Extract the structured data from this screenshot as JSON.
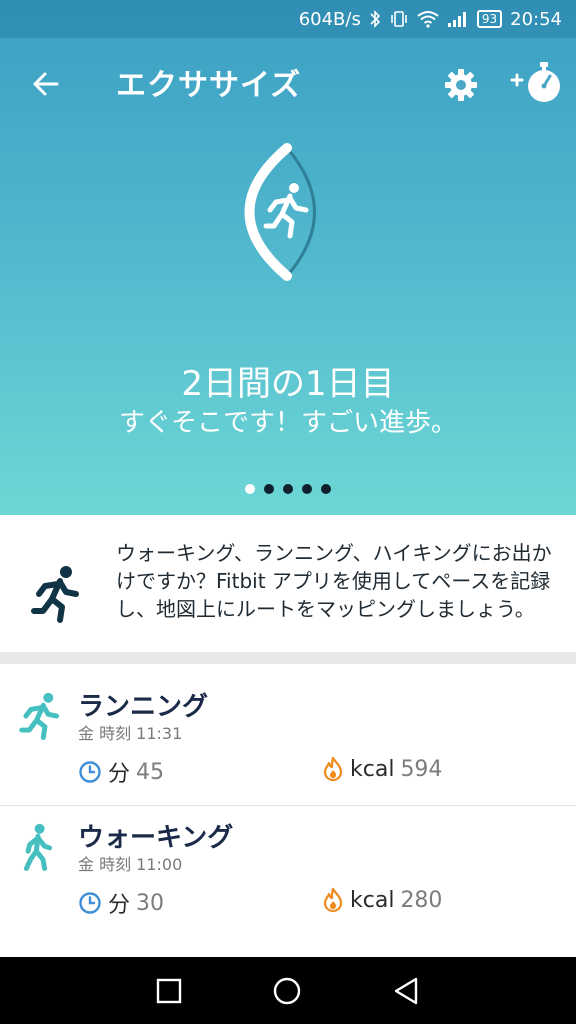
{
  "status_bar": {
    "speed": "604B/s",
    "battery": "93",
    "time": "20:54"
  },
  "app_bar": {
    "title": "エクササイズ",
    "icons": [
      "back-arrow-icon",
      "gear-icon",
      "add-timer-icon"
    ]
  },
  "hero": {
    "title": "2日間の1日目",
    "subtitle": "すぐそこです！すごい進歩。",
    "progress_days": 1,
    "goal_days": 2,
    "pager_total": 5,
    "pager_active": 0
  },
  "info_card": {
    "text": "ウォーキング、ランニング、ハイキングにお出かけですか？Fitbit アプリを使用してペースを記録し、地図上にルートをマッピングしましょう。"
  },
  "activities": [
    {
      "name": "ランニング",
      "time": "金 時刻 11:31",
      "duration_label": "分",
      "duration_value": "45",
      "calories_label": "kcal",
      "calories_value": "594"
    },
    {
      "name": "ウォーキング",
      "time": "金 時刻 11:00",
      "duration_label": "分",
      "duration_value": "30",
      "calories_label": "kcal",
      "calories_value": "280"
    }
  ],
  "colors": {
    "hero_top": "#3b9fc3",
    "hero_bottom": "#6dd7d6",
    "activity_icon": "#45bfc0",
    "title_text": "#1a2a48",
    "clock_icon": "#3f8fd6",
    "flame_icon": "#f08a1c"
  }
}
